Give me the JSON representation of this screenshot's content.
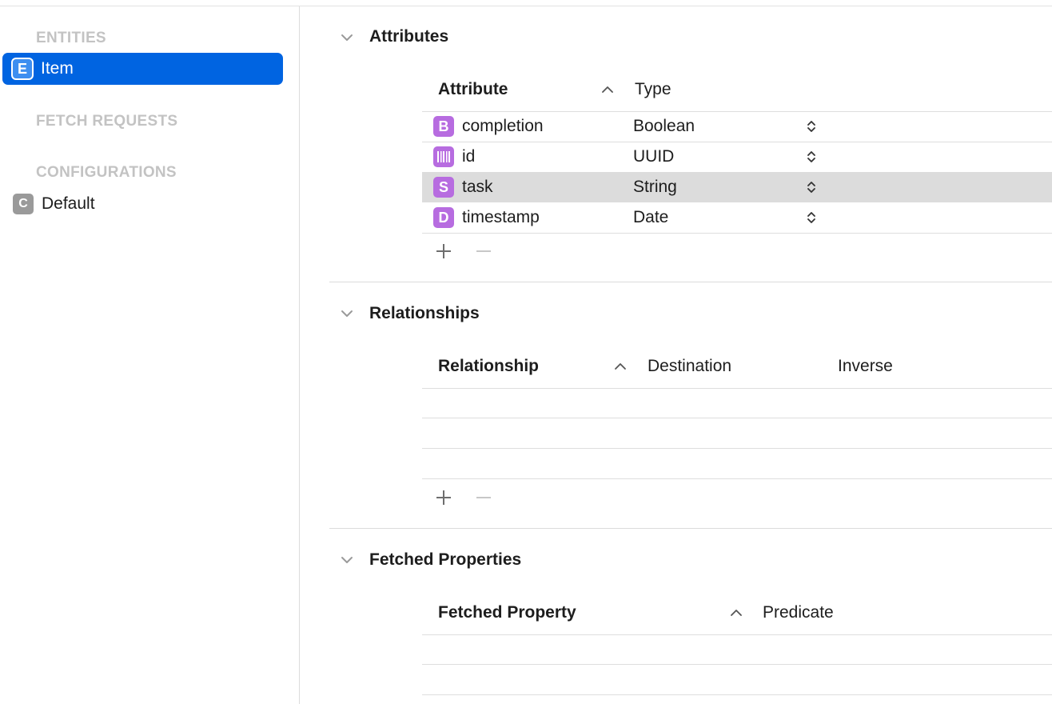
{
  "sidebar": {
    "entities_header": "ENTITIES",
    "entities": [
      {
        "badge": "E",
        "label": "Item",
        "selected": true
      }
    ],
    "fetch_requests_header": "FETCH REQUESTS",
    "configurations_header": "CONFIGURATIONS",
    "configurations": [
      {
        "badge": "C",
        "label": "Default"
      }
    ]
  },
  "attributes": {
    "title": "Attributes",
    "col_attribute": "Attribute",
    "col_type": "Type",
    "rows": [
      {
        "badge": "B",
        "name": "completion",
        "type": "Boolean"
      },
      {
        "badge": "",
        "name": "id",
        "type": "UUID"
      },
      {
        "badge": "S",
        "name": "task",
        "type": "String",
        "selected": true
      },
      {
        "badge": "D",
        "name": "timestamp",
        "type": "Date"
      }
    ]
  },
  "relationships": {
    "title": "Relationships",
    "col_relationship": "Relationship",
    "col_destination": "Destination",
    "col_inverse": "Inverse"
  },
  "fetched_properties": {
    "title": "Fetched Properties",
    "col_fetched_property": "Fetched Property",
    "col_predicate": "Predicate"
  },
  "colors": {
    "selection_blue": "#0064e1",
    "attribute_badge": "#b76ce0",
    "row_highlight": "#dcdcdc"
  },
  "icons": {
    "section_toggle": "chevron-down-icon",
    "sort": "sort-ascending-icon",
    "type_popup": "up-down-stepper-icon",
    "add": "plus-icon",
    "remove": "minus-icon",
    "uuid": "barcode-icon"
  }
}
